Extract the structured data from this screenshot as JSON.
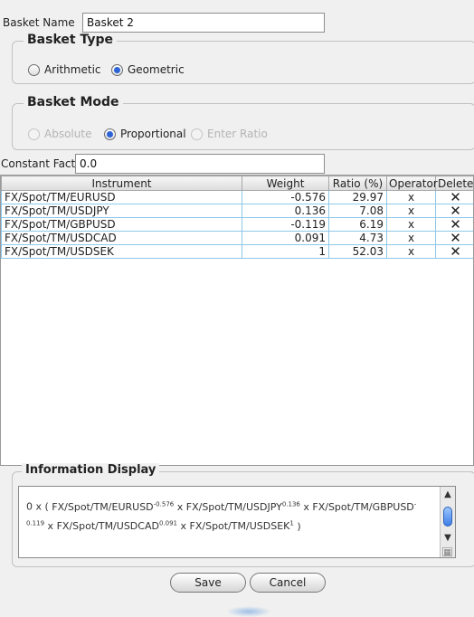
{
  "basket_name": {
    "label": "Basket Name",
    "value": "Basket 2"
  },
  "basket_type": {
    "title": "Basket Type",
    "options": [
      {
        "label": "Arithmetic",
        "selected": false,
        "enabled": true
      },
      {
        "label": "Geometric",
        "selected": true,
        "enabled": true
      }
    ]
  },
  "basket_mode": {
    "title": "Basket Mode",
    "options": [
      {
        "label": "Absolute",
        "selected": false,
        "enabled": false
      },
      {
        "label": "Proportional",
        "selected": true,
        "enabled": true
      },
      {
        "label": "Enter Ratio",
        "selected": false,
        "enabled": false
      }
    ]
  },
  "constant_factor": {
    "label": "Constant Factor",
    "value": "0.0"
  },
  "table": {
    "columns": [
      "Instrument",
      "Weight",
      "Ratio (%)",
      "Operator",
      "Delete"
    ],
    "rows": [
      {
        "instrument": "FX/Spot/TM/EURUSD",
        "weight": "-0.576",
        "ratio": "29.97",
        "operator": "x",
        "delete": "✕"
      },
      {
        "instrument": "FX/Spot/TM/USDJPY",
        "weight": "0.136",
        "ratio": "7.08",
        "operator": "x",
        "delete": "✕"
      },
      {
        "instrument": "FX/Spot/TM/GBPUSD",
        "weight": "-0.119",
        "ratio": "6.19",
        "operator": "x",
        "delete": "✕"
      },
      {
        "instrument": "FX/Spot/TM/USDCAD",
        "weight": "0.091",
        "ratio": "4.73",
        "operator": "x",
        "delete": "✕"
      },
      {
        "instrument": "FX/Spot/TM/USDSEK",
        "weight": "1",
        "ratio": "52.03",
        "operator": "x",
        "delete": "✕"
      }
    ]
  },
  "information_display": {
    "title": "Information Display",
    "prefix": "0 x (",
    "terms": [
      {
        "name": "FX/Spot/TM/EURUSD",
        "exp": "-0.576",
        "sep": "x"
      },
      {
        "name": "FX/Spot/TM/USDJPY",
        "exp": "0.136",
        "sep": "x"
      },
      {
        "name": "FX/Spot/TM/GBPUSD",
        "exp": "-0.119",
        "sep": "x"
      },
      {
        "name": "FX/Spot/TM/USDCAD",
        "exp": "0.091",
        "sep": "x"
      },
      {
        "name": "FX/Spot/TM/USDSEK",
        "exp": "1",
        "sep": ""
      }
    ],
    "suffix": ")"
  },
  "buttons": {
    "save": "Save",
    "cancel": "Cancel"
  },
  "icons": {
    "delete": "delete-x-icon",
    "scroll_up": "chevron-up-icon",
    "scroll_down": "chevron-down-icon"
  },
  "colors": {
    "accent": "#2c63d6",
    "table_grid": "#8ec8e8"
  }
}
